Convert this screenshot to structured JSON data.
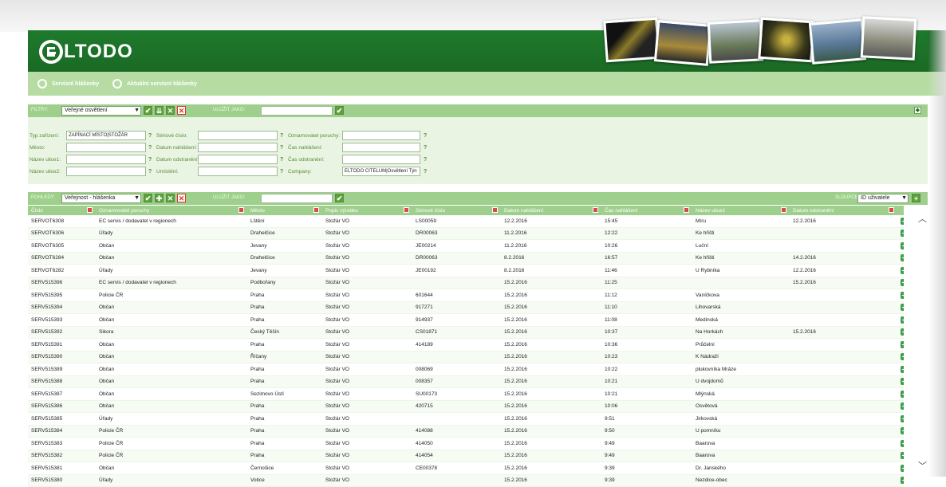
{
  "brand": {
    "logo_text": "LTODO"
  },
  "nav": {
    "link1": "Servisní hlášenky",
    "link2": "Aktuální servisní hlášenky"
  },
  "filters": {
    "bar_label": "FILTRY:",
    "selected": "Veřejné osvětlení",
    "save_as_label": "ULOŽIT JAKO:",
    "save_as_value": "",
    "fields": {
      "typ_zarizeni": {
        "label": "Typ zařízení:",
        "value": "ZAPÍNACÍ MÍSTO|STOŽÁR"
      },
      "seriove_cislo": {
        "label": "Sériové číslo:",
        "value": ""
      },
      "oznamovatel": {
        "label": "Oznamovatel poruchy:",
        "value": ""
      },
      "mesto": {
        "label": "Město:",
        "value": ""
      },
      "datum_nahlaseni": {
        "label": "Datum nahlášení:",
        "value": ""
      },
      "cas_nahlaseni": {
        "label": "Čas nahlášení:",
        "value": ""
      },
      "nazev_ulice1": {
        "label": "Název ulice1:",
        "value": ""
      },
      "datum_odstraneni": {
        "label": "Datum odstranění:",
        "value": ""
      },
      "cas_odstraneni": {
        "label": "Čas odstranění:",
        "value": ""
      },
      "nazev_ulice2": {
        "label": "Název ulice2:",
        "value": ""
      },
      "umisteni": {
        "label": "Umístění:",
        "value": ""
      },
      "company": {
        "label": "Company:",
        "value": "ELTODO CITELUM|Osvětlení Týn"
      }
    },
    "help": "?"
  },
  "views": {
    "bar_label": "POHLEDY:",
    "selected": "Veřejnost - hlášenka",
    "save_as_label": "ULOŽIT JAKO:",
    "save_as_value": "",
    "columns_label": "SLOUPCE:",
    "columns_selected": "ID uživatele"
  },
  "table": {
    "headers": [
      "Číslo",
      "Oznamovatel poruchy",
      "Město",
      "Popis výrobku",
      "Sériové číslo",
      "Datum nahlášení",
      "Čas nahlášení",
      "Název ulice1",
      "Datum odstranění"
    ],
    "rows": [
      [
        "SERVOT6308",
        "EC servis / dodavatel v regionech",
        "Lštění",
        "Stožár VO",
        "LS00059",
        "12.2.2016",
        "15:45",
        "Míru",
        "12.2.2016"
      ],
      [
        "SERVOT6306",
        "Úřady",
        "Drahelčice",
        "Stožár VO",
        "DR00063",
        "11.2.2016",
        "12:22",
        "Ke hřišti",
        ""
      ],
      [
        "SERVOT6305",
        "Občan",
        "Jevany",
        "Stožár VO",
        "JE00214",
        "11.2.2016",
        "10:26",
        "Luční",
        ""
      ],
      [
        "SERVOT6284",
        "Občan",
        "Drahelčice",
        "Stožár VO",
        "DR00063",
        "8.2.2016",
        "16:57",
        "Ke hřišti",
        "14.2.2016"
      ],
      [
        "SERVOT6282",
        "Úřady",
        "Jevany",
        "Stožár VO",
        "JE00192",
        "8.2.2016",
        "11:46",
        "U Rybníka",
        "12.2.2016"
      ],
      [
        "SERV515396",
        "EC servis / dodavatel v regionech",
        "Podbořany",
        "Stožár VO",
        "",
        "15.2.2016",
        "11:25",
        "",
        "15.2.2016"
      ],
      [
        "SERV515395",
        "Policie ČR",
        "Praha",
        "Stožár VO",
        "601644",
        "15.2.2016",
        "11:12",
        "Vaníčkova",
        ""
      ],
      [
        "SERV515394",
        "Občan",
        "Praha",
        "Stožár VO",
        "917271",
        "15.2.2016",
        "11:10",
        "Lihovarská",
        ""
      ],
      [
        "SERV515393",
        "Občan",
        "Praha",
        "Stožár VO",
        "914937",
        "15.2.2016",
        "11:08",
        "Medinská",
        ""
      ],
      [
        "SERV515392",
        "Sikora",
        "Český Těšín",
        "Stožár VO",
        "CS01871",
        "15.2.2016",
        "10:37",
        "Na Horkách",
        "15.2.2016"
      ],
      [
        "SERV515391",
        "Občan",
        "Praha",
        "Stožár VO",
        "414189",
        "15.2.2016",
        "10:36",
        "Průčelní",
        ""
      ],
      [
        "SERV515390",
        "Občan",
        "Říčany",
        "Stožár VO",
        "",
        "15.2.2016",
        "10:23",
        "K Nádraží",
        ""
      ],
      [
        "SERV515389",
        "Občan",
        "Praha",
        "Stožár VO",
        "008069",
        "15.2.2016",
        "10:22",
        "plukovníka Mráze",
        ""
      ],
      [
        "SERV515388",
        "Občan",
        "Praha",
        "Stožár VO",
        "008357",
        "15.2.2016",
        "10:21",
        "U dvojdomů",
        ""
      ],
      [
        "SERV515387",
        "Občan",
        "Sezimovo Ústí",
        "Stožár VO",
        "SU00173",
        "15.2.2016",
        "10:21",
        "Mlýnská",
        ""
      ],
      [
        "SERV515386",
        "Občan",
        "Praha",
        "Stožár VO",
        "420715",
        "15.2.2016",
        "10:06",
        "Osvětová",
        ""
      ],
      [
        "SERV515385",
        "Úřady",
        "Praha",
        "Stožár VO",
        "",
        "15.2.2016",
        "9:51",
        "Jirkovská",
        ""
      ],
      [
        "SERV515384",
        "Policie ČR",
        "Praha",
        "Stožár VO",
        "414088",
        "15.2.2016",
        "9:50",
        "U pomníku",
        ""
      ],
      [
        "SERV515383",
        "Policie ČR",
        "Praha",
        "Stožár VO",
        "414050",
        "15.2.2016",
        "9:49",
        "Baarova",
        ""
      ],
      [
        "SERV515382",
        "Policie ČR",
        "Praha",
        "Stožár VO",
        "414054",
        "15.2.2016",
        "9:49",
        "Baarova",
        ""
      ],
      [
        "SERV515381",
        "Občan",
        "Černošice",
        "Stožár VO",
        "CE00378",
        "15.2.2016",
        "9:39",
        "Dr. Janského",
        ""
      ],
      [
        "SERV515380",
        "Úřady",
        "Votice",
        "Stožár VO",
        "",
        "15.2.2016",
        "9:39",
        "Nezdice-obec",
        ""
      ]
    ]
  },
  "colors": {
    "header_green": "#1f7a2c",
    "light_green": "#b6dca3",
    "bar_green": "#9fcf8c",
    "filter_bg": "#e9f5e2"
  }
}
